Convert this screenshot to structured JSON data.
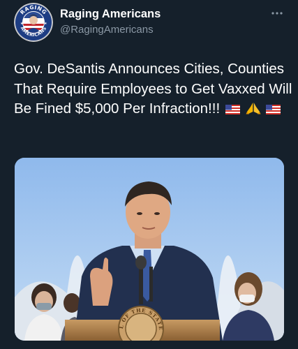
{
  "account": {
    "display_name": "Raging Americans",
    "handle": "@RagingAmericans",
    "avatar_text_top": "RAGING",
    "avatar_text_bottom": "AMERICANS"
  },
  "more_icon": "more-horizontal-icon",
  "tweet": {
    "text": "Gov. DeSantis Announces Cities, Counties That Require Employees to Get Vaxxed Will Be Fined $5,000 Per Infraction!!!",
    "emojis": [
      "us-flag-icon",
      "folded-hands-icon",
      "us-flag-icon"
    ]
  },
  "media": {
    "seal_text": "SEAL OF THE STATE OF"
  },
  "colors": {
    "background": "#15202b",
    "text": "#ffffff",
    "secondary_text": "#8b98a5"
  }
}
